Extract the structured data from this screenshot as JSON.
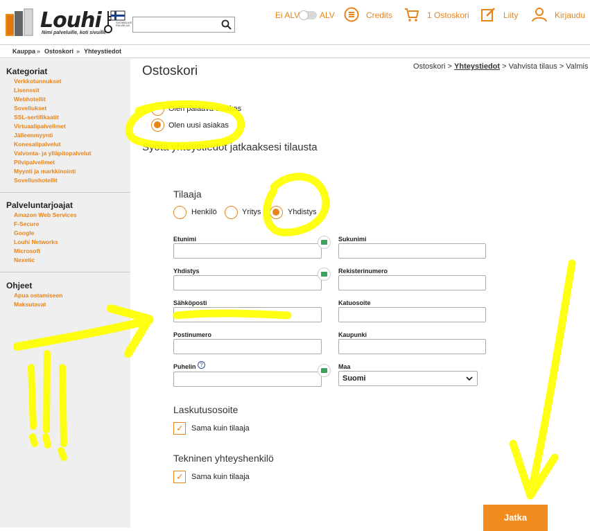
{
  "colors": {
    "accent": "#e8841a",
    "button": "#f28c1e",
    "sidebar_bg": "#efefef",
    "highlighter": "#ffff00"
  },
  "header": {
    "logo_text": "Louhi",
    "tagline": "Nimi palveluille, koti sivuille",
    "flag_text": "SUOMALAISTA PALVELUA",
    "search_placeholder": "",
    "vat_off_label": "Ei ALV",
    "vat_on_label": "ALV",
    "credits_label": "Credits",
    "cart_label": "1 Ostoskori",
    "join_label": "Liity",
    "login_label": "Kirjaudu"
  },
  "breadcrumb": {
    "items": [
      "Kauppa",
      "Ostoskori",
      "Yhteystiedot"
    ],
    "separator": "»"
  },
  "sidebar": {
    "categories": {
      "title": "Kategoriat",
      "items": [
        "Verkkotunnukset",
        "Lisenssit",
        "Webhotellit",
        "Sovellukset",
        "SSL-sertifikaatit",
        "Virtuaalipalvelimet",
        "Jälleenmyynti",
        "Konesalipalvelut",
        "Valvonta- ja ylläpitopalvelut",
        "Pilvipalvelimet",
        "Myynti ja markkinointi",
        "Sovellushotellit"
      ]
    },
    "providers": {
      "title": "Palveluntarjoajat",
      "items": [
        "Amazon Web Services",
        "F-Secure",
        "Google",
        "Louhi Networks",
        "Microsoft",
        "Nexetic"
      ]
    },
    "help": {
      "title": "Ohjeet",
      "items": [
        "Apua ostamiseen",
        "Maksutavat"
      ]
    }
  },
  "main": {
    "title": "Ostoskori",
    "steps": {
      "s1": "Ostoskori",
      "s2": "Yhteystiedot",
      "s3": "Vahvista tilaus",
      "s4": "Valmis",
      "sep": ">"
    },
    "customer_type": {
      "returning": "Olen palaava asiakas",
      "new": "Olen uusi asiakas",
      "selected": "new"
    },
    "subtitle": "Syötä yhteystiedot jatkaaksesi tilausta",
    "orderer": {
      "title": "Tilaaja",
      "types": [
        "Henkilö",
        "Yritys",
        "Yhdistys"
      ],
      "selected": "Yhdistys"
    },
    "fields": {
      "first_name": {
        "label": "Etunimi",
        "value": ""
      },
      "last_name": {
        "label": "Sukunimi",
        "value": ""
      },
      "association": {
        "label": "Yhdistys",
        "value": ""
      },
      "reg_number": {
        "label": "Rekisterinumero",
        "value": ""
      },
      "email": {
        "label": "Sähköposti",
        "value": ""
      },
      "street": {
        "label": "Katuosoite",
        "value": ""
      },
      "postal_code": {
        "label": "Postinumero",
        "value": ""
      },
      "city": {
        "label": "Kaupunki",
        "value": ""
      },
      "phone": {
        "label": "Puhelin",
        "value": ""
      },
      "country": {
        "label": "Maa",
        "value": "Suomi"
      }
    },
    "help_glyph": "?",
    "billing": {
      "title": "Laskutusosoite",
      "same_label": "Sama kuin tilaaja",
      "checked": true
    },
    "technical": {
      "title": "Tekninen yhteyshenkilö",
      "same_label": "Sama kuin tilaaja",
      "checked": true
    },
    "continue_label": "Jatka"
  }
}
